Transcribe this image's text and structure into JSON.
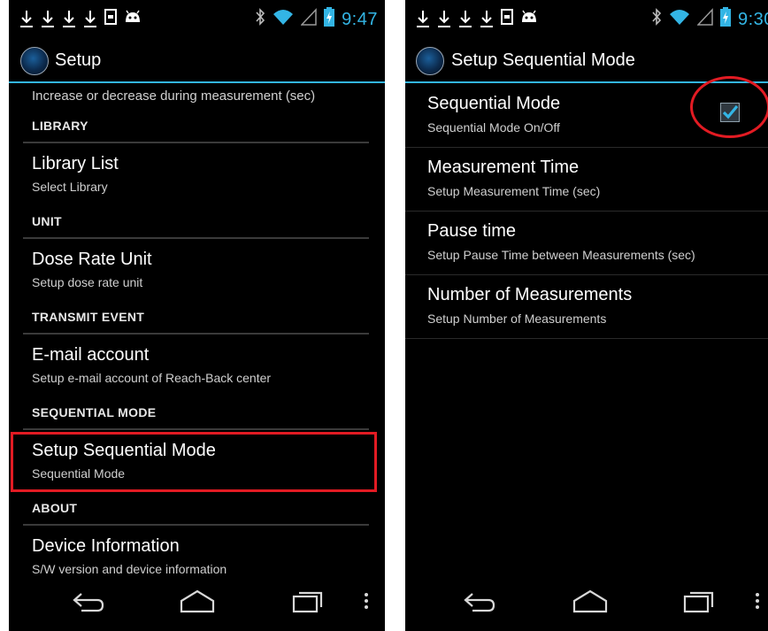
{
  "left_screen": {
    "status_time": "9:47",
    "app_title": "Setup",
    "partial_summary": "Increase or decrease during measurement (sec)",
    "categories": {
      "library": "LIBRARY",
      "unit": "UNIT",
      "transmit_event": "TRANSMIT EVENT",
      "sequential_mode": "SEQUENTIAL MODE",
      "about": "ABOUT"
    },
    "prefs": {
      "library_list": {
        "title": "Library List",
        "summary": "Select Library"
      },
      "dose_rate_unit": {
        "title": "Dose Rate Unit",
        "summary": "Setup dose rate unit"
      },
      "email_account": {
        "title": "E-mail account",
        "summary": "Setup e-mail account of Reach-Back center"
      },
      "setup_sequential_mode": {
        "title": "Setup Sequential Mode",
        "summary": "Sequential Mode"
      },
      "device_information": {
        "title": "Device Information",
        "summary": "S/W version and device information"
      }
    }
  },
  "right_screen": {
    "status_time": "9:30",
    "app_title": "Setup Sequential Mode",
    "prefs": [
      {
        "title": "Sequential Mode",
        "summary": "Sequential Mode On/Off",
        "checked": true
      },
      {
        "title": "Measurement Time",
        "summary": "Setup Measurement Time (sec)"
      },
      {
        "title": "Pause time",
        "summary": "Setup Pause Time between Measurements (sec)"
      },
      {
        "title": "Number of Measurements",
        "summary": "Setup Number of Measurements"
      }
    ]
  },
  "icons": {
    "status_left": [
      "download-icon",
      "download-icon",
      "download-icon",
      "download-icon",
      "sd-card-icon",
      "android-icon"
    ],
    "status_right": [
      "bluetooth-icon",
      "wifi-icon",
      "signal-icon",
      "battery-charging-icon"
    ],
    "navbar": [
      "back-icon",
      "home-icon",
      "recent-apps-icon",
      "overflow-menu-icon"
    ]
  },
  "colors": {
    "accent": "#33b5e5",
    "annotation_red": "#e21b23",
    "background": "#000000"
  }
}
